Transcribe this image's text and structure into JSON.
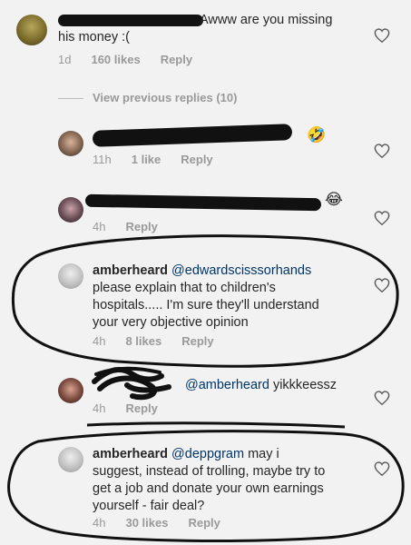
{
  "comments": [
    {
      "text": "Awww are you missing his money :(",
      "meta": {
        "time": "1d",
        "likes": "160 likes",
        "reply": "Reply"
      }
    },
    {
      "text": "",
      "meta": {
        "time": "11h",
        "likes": "1 like",
        "reply": "Reply"
      }
    },
    {
      "text": "",
      "meta": {
        "time": "4h",
        "likes": "",
        "reply": "Reply"
      }
    },
    {
      "username": "amberheard",
      "mention": "@edwardscisssorhands",
      "text_lines": [
        "please explain that to children's",
        "hospitals..... I'm sure they'll understand",
        "your very objective opinion"
      ],
      "meta": {
        "time": "4h",
        "likes": "8 likes",
        "reply": "Reply"
      }
    },
    {
      "mention": "@amberheard",
      "text": "yikkkeessz",
      "meta": {
        "time": "4h",
        "likes": "",
        "reply": "Reply"
      }
    },
    {
      "username": "amberheard",
      "mention": "@deppgram",
      "first_line_rest": "may i",
      "text_lines": [
        "suggest, instead of trolling, maybe try to",
        "get a job and donate your own earnings",
        "yourself - fair deal?"
      ],
      "meta": {
        "time": "4h",
        "likes": "30 likes",
        "reply": "Reply"
      }
    }
  ],
  "view_previous": "View previous replies (10)",
  "emoji": {
    "laugh": "🤣",
    "joy": "😂"
  },
  "icons": {
    "like": "heart-icon"
  },
  "colors": {
    "mention": "#003569",
    "meta": "#999999",
    "text": "#262626"
  }
}
